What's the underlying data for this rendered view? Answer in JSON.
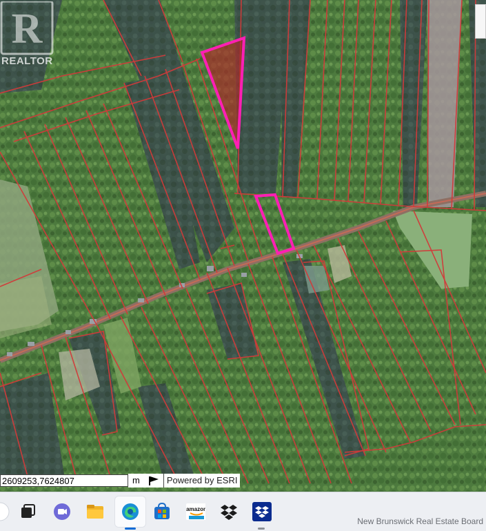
{
  "logo": {
    "text": "REALTOR"
  },
  "coordinates": {
    "value": "2609253,7624807"
  },
  "units": {
    "label": "m"
  },
  "attribution": {
    "text": "Powered by ESRI"
  },
  "watermark": {
    "text": "New Brunswick Real Estate Board"
  },
  "taskbar": {
    "icons": [
      "start-icon",
      "task-view-icon",
      "teams-icon",
      "file-explorer-icon",
      "edge-icon",
      "store-icon",
      "amazon-icon",
      "dropbox-icon",
      "dropbox-app-icon"
    ],
    "amazon_label": "amazon"
  },
  "colors": {
    "parcel_line": "#d23a3a",
    "highlight": "#ff1fb4",
    "highlight_fill": "#b02a2a",
    "road": "#b85a4c"
  }
}
